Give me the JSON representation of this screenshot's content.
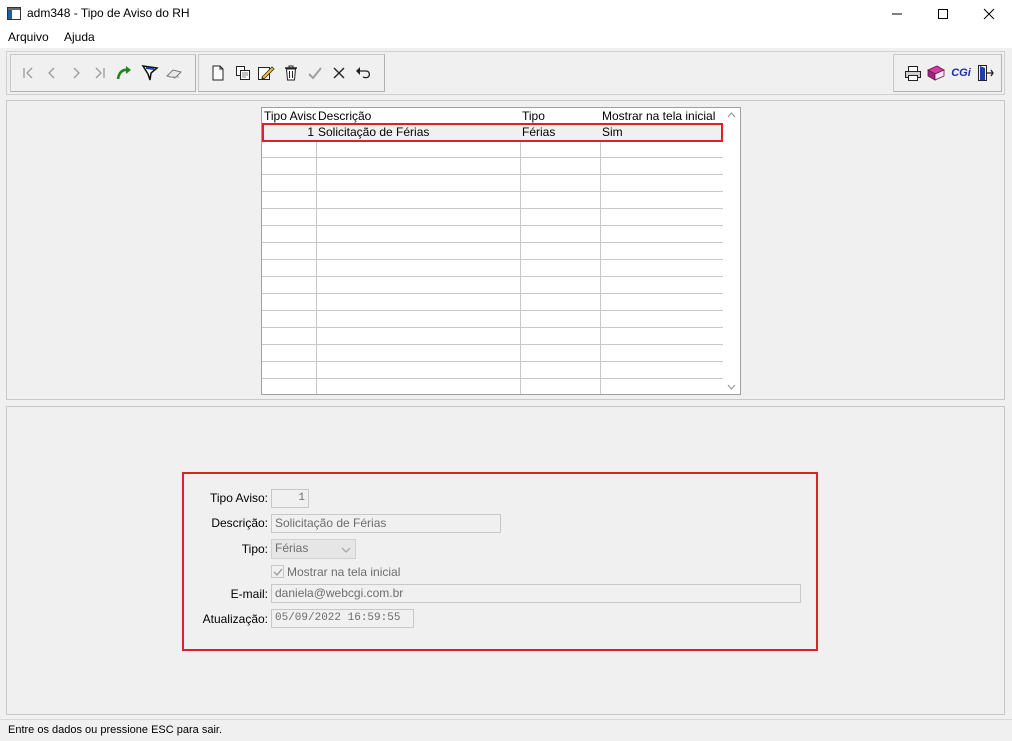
{
  "window": {
    "title": "adm348 - Tipo de Aviso do RH",
    "minimize": "—",
    "maximize": "☐",
    "close": "✕"
  },
  "menu": [
    "Arquivo",
    "Ajuda"
  ],
  "toolbar": {
    "cgi_label": "CGi"
  },
  "grid": {
    "columns": [
      "Tipo Aviso",
      "Descrição",
      "Tipo",
      "Mostrar na tela inicial"
    ],
    "rows": [
      [
        "1",
        "Solicitação de Férias",
        "Férias",
        "Sim"
      ]
    ]
  },
  "form": {
    "tipo_aviso_label": "Tipo Aviso:",
    "tipo_aviso_value": "1",
    "descricao_label": "Descrição:",
    "descricao_value": "Solicitação de Férias",
    "tipo_label": "Tipo:",
    "tipo_value": "Férias",
    "mostrar_label": "Mostrar na tela inicial",
    "mostrar_checked": true,
    "email_label": "E-mail:",
    "email_value": "daniela@webcgi.com.br",
    "atualizacao_label": "Atualização:",
    "atualizacao_value": "05/09/2022 16:59:55"
  },
  "status": "Entre os dados ou pressione ESC para sair.",
  "colors": {
    "highlight": "#d9222a"
  }
}
